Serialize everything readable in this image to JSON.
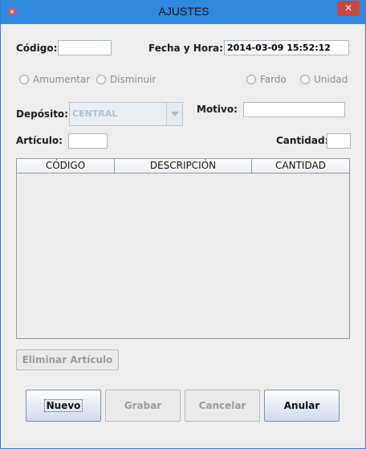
{
  "window": {
    "title": "AJUSTES",
    "close_symbol": "✕"
  },
  "form": {
    "codigo_label": "Código:",
    "codigo_value": "",
    "fecha_label": "Fecha y Hora:",
    "fecha_value": "2014-03-09 15:52:12",
    "radio_aumentar": "Amumentar",
    "radio_disminuir": "Disminuir",
    "radio_fardo": "Fardo",
    "radio_unidad": "Unidad",
    "deposito_label": "Depósito:",
    "deposito_value": "CENTRAL",
    "motivo_label": "Motivo:",
    "motivo_value": "",
    "articulo_label": "Artículo:",
    "articulo_value": "",
    "cantidad_label": "Cantidad:",
    "cantidad_value": ""
  },
  "table": {
    "columns": [
      "CÓDIGO",
      "DESCRIPCIÓN",
      "CANTIDAD"
    ],
    "rows": []
  },
  "buttons": {
    "eliminar": "Eliminar Artículo",
    "nuevo": "Nuevo",
    "grabar": "Grabar",
    "cancelar": "Cancelar",
    "anular": "Anular"
  },
  "colors": {
    "titlebar": "#2f8ae0",
    "close_button": "#c7493b",
    "disabled_text": "#8d8d8d"
  },
  "icons": {
    "app": "java-cup-icon",
    "dropdown": "chevron-down-icon"
  }
}
